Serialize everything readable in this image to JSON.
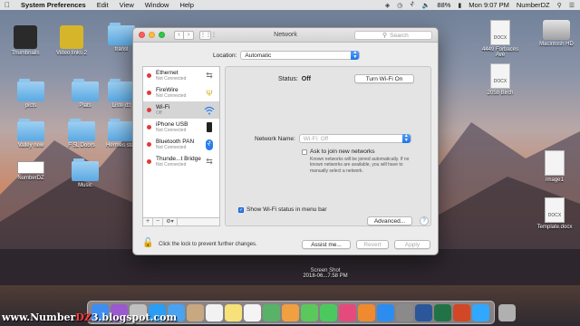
{
  "menubar": {
    "apple_icon": "apple-icon",
    "app_name": "System Preferences",
    "items": [
      "Edit",
      "View",
      "Window",
      "Help"
    ],
    "battery": "88%",
    "clock": "Mon 9:07 PM",
    "user": "NumberDZ"
  },
  "desktop": {
    "icons": [
      {
        "label": "Thumbnails",
        "kind": "dark"
      },
      {
        "label": "Video links 2",
        "kind": "dark"
      },
      {
        "label": "transl",
        "kind": "folder"
      },
      {
        "label": "picts",
        "kind": "folder"
      },
      {
        "label": "Plats",
        "kind": "folder"
      },
      {
        "label": "Liste dz",
        "kind": "folder"
      },
      {
        "label": "Valley new",
        "kind": "folder"
      },
      {
        "label": "F 5L Doors",
        "kind": "folder"
      },
      {
        "label": "Hermes stair",
        "kind": "folder"
      },
      {
        "label": "NumberDZ",
        "kind": "doc"
      },
      {
        "label": "Music",
        "kind": "folder"
      },
      {
        "label": "4449 Forbaces Ave",
        "kind": "doc"
      },
      {
        "label": "Macintosh HD",
        "kind": "drive"
      },
      {
        "label": "2058 Birch",
        "kind": "doc"
      },
      {
        "label": "image1",
        "kind": "doc"
      },
      {
        "label": "Template.docx",
        "kind": "doc"
      }
    ],
    "screenshot_label_1": "Screen Shot",
    "screenshot_label_2": "2018-06...7.58 PM"
  },
  "window": {
    "title": "Network",
    "search_placeholder": "Search",
    "location_label": "Location:",
    "location_value": "Automatic",
    "services": [
      {
        "name": "Ethernet",
        "status": "Not Connected",
        "icon": "ethernet-icon",
        "selected": false
      },
      {
        "name": "FireWire",
        "status": "Not Connected",
        "icon": "firewire-icon",
        "selected": false
      },
      {
        "name": "Wi-Fi",
        "status": "Off",
        "icon": "wifi-icon",
        "selected": true
      },
      {
        "name": "iPhone USB",
        "status": "Not Connected",
        "icon": "iphone-icon",
        "selected": false
      },
      {
        "name": "Bluetooth PAN",
        "status": "Not Connected",
        "icon": "bluetooth-icon",
        "selected": false
      },
      {
        "name": "Thunde...t Bridge",
        "status": "Not Connected",
        "icon": "thunderbolt-icon",
        "selected": false
      }
    ],
    "list_toolbar": {
      "add": "+",
      "remove": "−",
      "gear": "⚙▾"
    },
    "status_label": "Status:",
    "status_value": "Off",
    "turn_on_button": "Turn Wi-Fi On",
    "network_name_label": "Network Name:",
    "network_name_value": "Wi-Fi: Off",
    "ask_checkbox_label": "Ask to join new networks",
    "ask_description": "Known networks will be joined automatically. If no known networks are available, you will have to manually select a network.",
    "show_wifi_label": "Show Wi-Fi status in menu bar",
    "advanced_button": "Advanced...",
    "help_button": "?",
    "lock_text": "Click the lock to prevent further changes.",
    "assist_button": "Assist me...",
    "revert_button": "Revert",
    "apply_button": "Apply"
  },
  "watermark": {
    "prefix": "www.Number",
    "accent": "DZ",
    "suffix": "3.blogspot.com"
  },
  "dock_apps": [
    "finder",
    "siri",
    "launchpad",
    "safari",
    "mail",
    "contacts",
    "calendar",
    "notes",
    "reminders",
    "maps",
    "photos",
    "messages",
    "facetime",
    "itunes",
    "ibooks",
    "app-store",
    "system-preferences",
    "word",
    "excel",
    "powerpoint",
    "photoshop",
    "trash"
  ]
}
